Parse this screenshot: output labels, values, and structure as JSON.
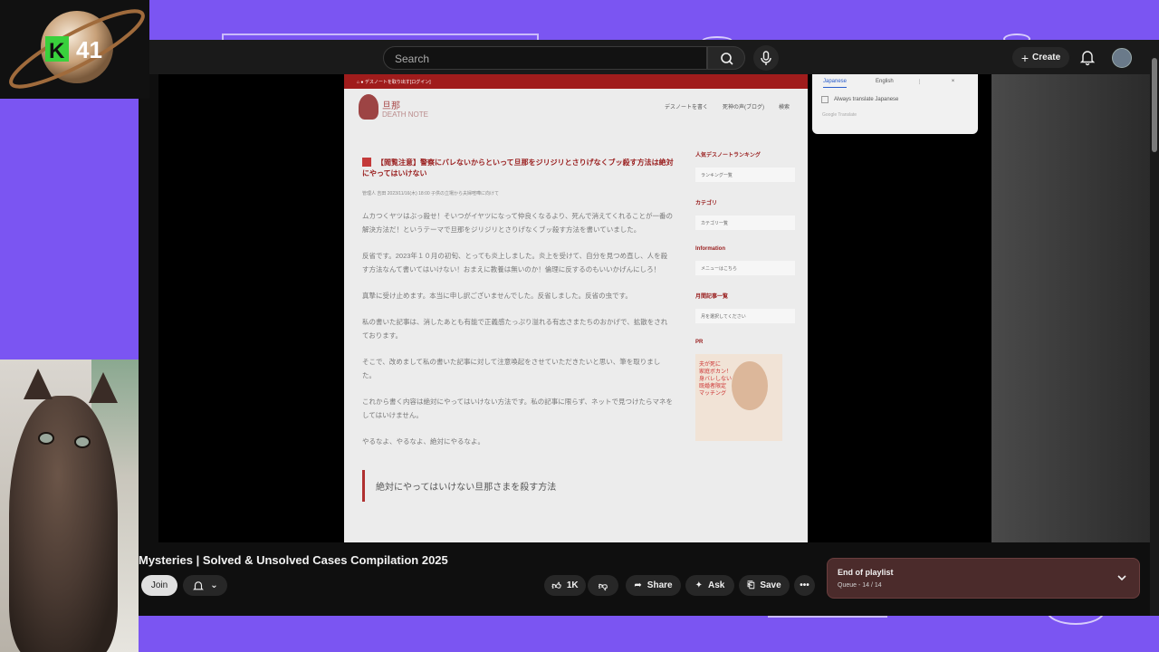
{
  "colors": {
    "backdrop": "#7b55f2",
    "yt_dark": "#0f0f0f",
    "accent_red": "#a01c1c",
    "playlist_bg": "#4b2b2b"
  },
  "stream_logo": {
    "text": "41"
  },
  "topbar": {
    "search_placeholder": "Search",
    "search_icon": "search-icon",
    "mic_icon": "microphone-icon",
    "create_label": "Create",
    "bell_icon": "bell-icon"
  },
  "embedded_page": {
    "top_bar_text": "デスノートを取り出す[ログイン]",
    "site_name": "旦那",
    "site_subtitle": "DEATH NOTE",
    "nav": [
      "デスノートを書く",
      "死神の声(ブログ)",
      "検索"
    ],
    "article_title": "【閲覧注意】警察にバレないからといって旦那をジリジリとさりげなくブッ殺す方法は絶対にやってはいけない",
    "article_meta": "管理人 吉田   2023/11/16(木) 18:00   子供の立場から夫婦喧嘩に向けて",
    "paragraphs": [
      "ムカつくヤツはぶっ殺せ！そいつがイヤツになって仲良くなるより、死んで消えてくれることが一番の解決方法だ！というテーマで旦那をジリジリとさりげなくブッ殺す方法を書いていました。",
      "反省です。2023年１０月の初旬、とっても炎上しました。炎上を受けて、自分を見つめ直し、人を殺す方法なんて書いてはいけない！おまえに教養は無いのか！倫理に反するのもいいかげんにしろ！",
      "真摯に受け止めます。本当に申し訳ございませんでした。反省しました。反省の虫です。",
      "私の書いた記事は、消したあとも有能で正義感たっぷり溢れる有志さまたちのおかげで、拡散をされております。",
      "そこで、改めまして私の書いた記事に対して注意喚起をさせていただきたいと思い、筆を取りました。",
      "これから書く内容は絶対にやってはいけない方法です。私の記事に限らず、ネットで見つけたらマネをしてはいけません。",
      "やるなよ、やるなよ、絶対にやるなよ。"
    ],
    "heading2": "絶対にやってはいけない旦那さまを殺す方法",
    "sidebar": [
      {
        "heading": "人気デスノートランキング",
        "select": "ランキング一覧"
      },
      {
        "heading": "カテゴリ",
        "select": "カテゴリ一覧"
      },
      {
        "heading": "Information",
        "select": "メニューはこちら"
      },
      {
        "heading": "月間記事一覧",
        "select": "月を選択してください"
      }
    ],
    "pr_heading": "PR",
    "pr_text": "夫が死に\n家庭ボカン！\n身バレしない\n既婚者限定\nマッチング"
  },
  "translate_popup": {
    "tabs": [
      "Japanese",
      "English"
    ],
    "checkbox_label": "Always translate Japanese",
    "footer": "Google Translate"
  },
  "video": {
    "title": "Mysteries | Solved & Unsolved Cases Compilation 2025",
    "join_label": "Join",
    "like_count": "1K",
    "share_label": "Share",
    "ask_label": "Ask",
    "save_label": "Save"
  },
  "playlist": {
    "title": "End of playlist",
    "subtitle": "Queue - 14 / 14"
  }
}
